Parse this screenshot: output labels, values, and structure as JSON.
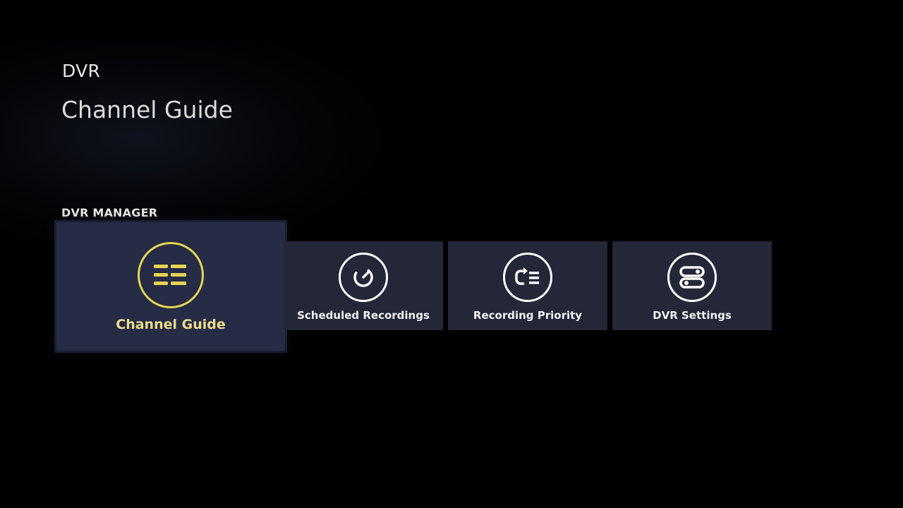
{
  "header": {
    "breadcrumb": "DVR",
    "title": "Channel Guide"
  },
  "section": {
    "label": "DVR MANAGER"
  },
  "tiles": [
    {
      "label": "Channel Guide",
      "icon": "channel-guide-list-icon",
      "focused": true
    },
    {
      "label": "Scheduled Recordings",
      "icon": "clock-icon",
      "focused": false
    },
    {
      "label": "Recording Priority",
      "icon": "priority-list-icon",
      "focused": false
    },
    {
      "label": "DVR Settings",
      "icon": "toggle-settings-icon",
      "focused": false
    }
  ],
  "colors": {
    "background": "#000000",
    "tile": "#232737",
    "tile_focused": "#262c45",
    "focus_accent": "#e5d451"
  }
}
